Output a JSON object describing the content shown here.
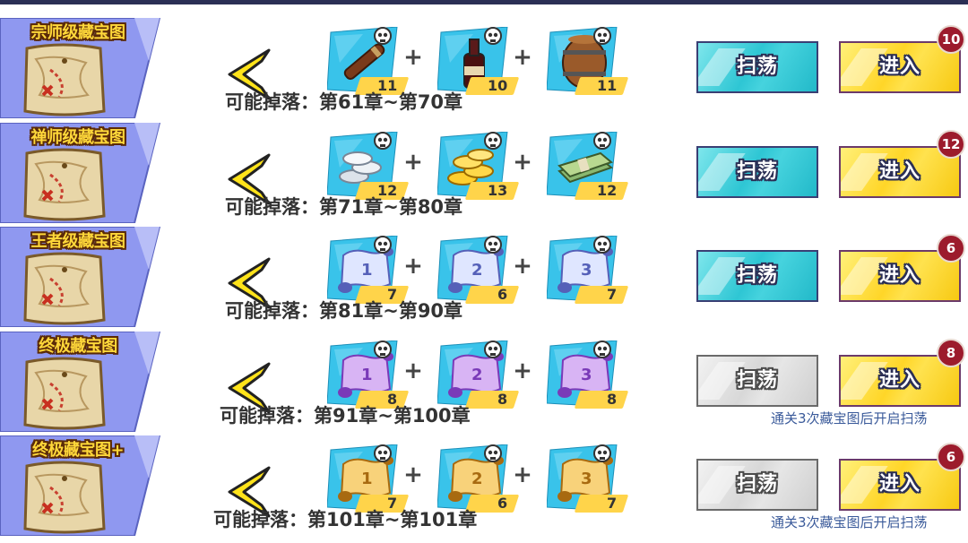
{
  "rows": [
    {
      "title": "宗师级藏宝图",
      "items": [
        {
          "icon": "cigar-icon",
          "qty": "11"
        },
        {
          "icon": "bottle-icon",
          "qty": "10"
        },
        {
          "icon": "barrel-icon",
          "qty": "11"
        }
      ],
      "drop": "可能掉落：第61章~第70章",
      "sweep_label": "扫荡",
      "sweep_enabled": true,
      "enter_label": "进入",
      "badge": "10",
      "hint": ""
    },
    {
      "title": "禅师级藏宝图",
      "items": [
        {
          "icon": "silver-coins-icon",
          "qty": "12"
        },
        {
          "icon": "gold-coins-icon",
          "qty": "13"
        },
        {
          "icon": "cash-stack-icon",
          "qty": "12"
        }
      ],
      "drop": "可能掉落：第71章~第80章",
      "sweep_label": "扫荡",
      "sweep_enabled": true,
      "enter_label": "进入",
      "badge": "12",
      "hint": ""
    },
    {
      "title": "王者级藏宝图",
      "items": [
        {
          "icon": "blue-scroll-1-icon",
          "qty": "7"
        },
        {
          "icon": "blue-scroll-2-icon",
          "qty": "6"
        },
        {
          "icon": "blue-scroll-3-icon",
          "qty": "7"
        }
      ],
      "drop": "可能掉落：第81章~第90章",
      "sweep_label": "扫荡",
      "sweep_enabled": true,
      "enter_label": "进入",
      "badge": "6",
      "hint": ""
    },
    {
      "title": "终极藏宝图",
      "items": [
        {
          "icon": "purple-scroll-1-icon",
          "qty": "8"
        },
        {
          "icon": "purple-scroll-2-icon",
          "qty": "8"
        },
        {
          "icon": "purple-scroll-3-icon",
          "qty": "8"
        }
      ],
      "drop": "可能掉落：第91章~第100章",
      "sweep_label": "扫荡",
      "sweep_enabled": false,
      "enter_label": "进入",
      "badge": "8",
      "hint": "通关3次藏宝图后开启扫荡"
    },
    {
      "title": "终极藏宝图+",
      "items": [
        {
          "icon": "gold-scroll-1-icon",
          "qty": "7"
        },
        {
          "icon": "gold-scroll-2-icon",
          "qty": "6"
        },
        {
          "icon": "gold-scroll-3-icon",
          "qty": "7"
        }
      ],
      "drop": "可能掉落：第101章~第101章",
      "sweep_label": "扫荡",
      "sweep_enabled": false,
      "enter_label": "进入",
      "badge": "6",
      "hint": "通关3次藏宝图后开启扫荡"
    }
  ],
  "colors": {
    "card_blue": "#8f98f0",
    "item_blue": "#39c3ea",
    "qty_yellow": "#ffd44a",
    "sweep_cyan": "#2ec6d4",
    "enter_yellow": "#ffd628",
    "badge_red": "#9c1b2c",
    "back_yellow": "#ffe31a"
  }
}
